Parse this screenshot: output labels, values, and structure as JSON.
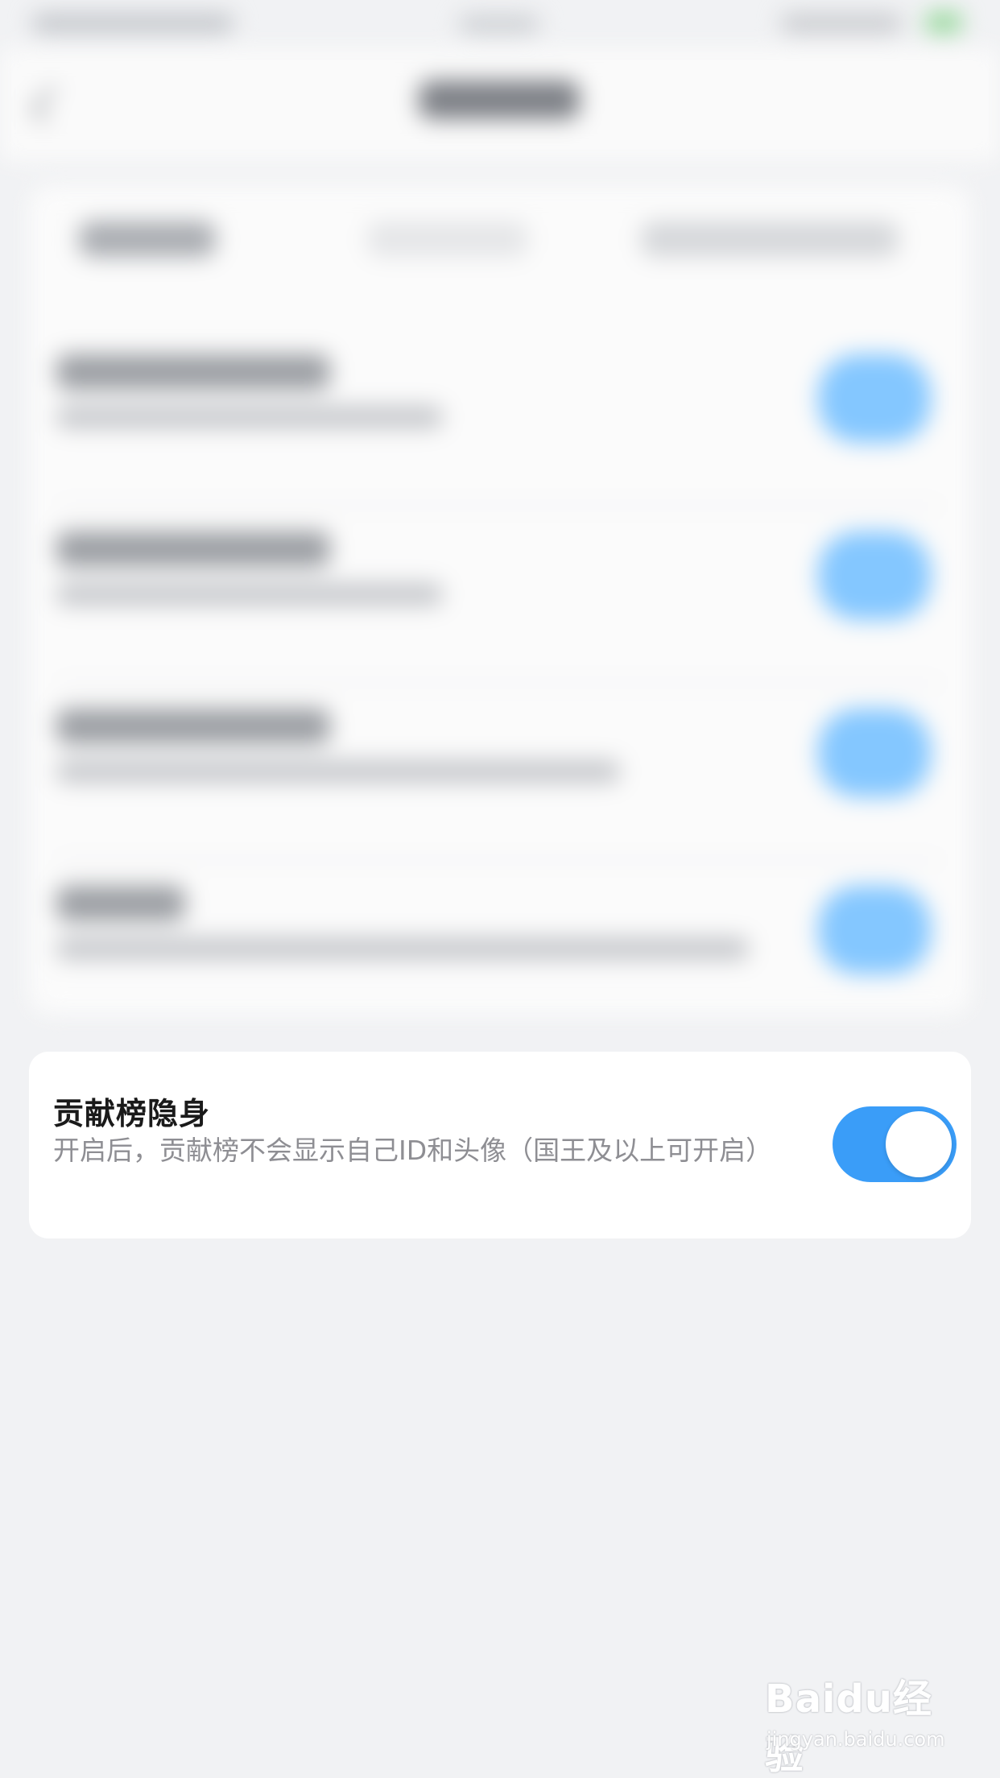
{
  "setting": {
    "title": "贡献榜隐身",
    "description": "开启后，贡献榜不会显示自己ID和头像（国王及以上可开启）",
    "enabled": true
  },
  "watermark": {
    "brand": "Baidu经验",
    "url": "jingyan.baidu.com"
  },
  "colors": {
    "accent": "#3a9df8",
    "background": "#f1f2f4",
    "card": "#ffffff",
    "title_text": "#1a1a1a",
    "secondary_text": "#8e8e93"
  }
}
